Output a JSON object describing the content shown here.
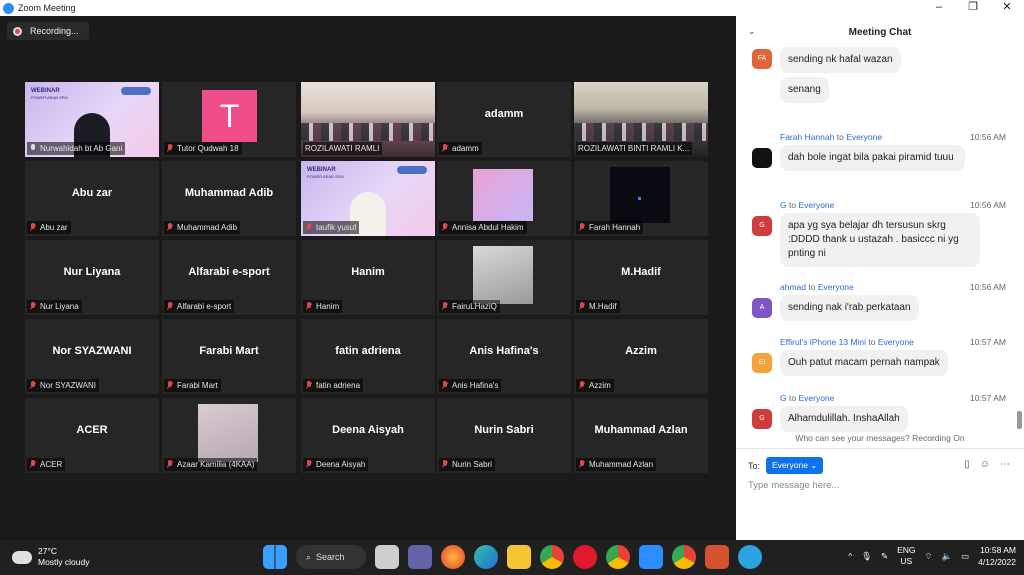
{
  "window": {
    "title": "Zoom Meeting",
    "controls": [
      "–",
      "❐",
      "✕"
    ]
  },
  "recording": {
    "label": "Recording..."
  },
  "tiles": [
    {
      "name": "Nurwahidah bt Ab Gani",
      "center": "",
      "video": "webinar-woman",
      "mic": "on"
    },
    {
      "name": "Tutor Qudwah 18",
      "center": "",
      "video": "avatar-T",
      "avatar_letter": "T",
      "mic": "off"
    },
    {
      "name": "ROZILAWATI RAMLI",
      "center": "",
      "video": "class-photo",
      "mic": "none"
    },
    {
      "name": "adamm",
      "center": "adamm",
      "video": "",
      "mic": "off"
    },
    {
      "name": "ROZILAWATI BINTI RAMLI K...",
      "center": "",
      "video": "class-photo2",
      "mic": "none"
    },
    {
      "name": "Abu zar",
      "center": "Abu zar",
      "video": "",
      "mic": "off"
    },
    {
      "name": "Muhammad Adib",
      "center": "Muhammad Adib",
      "video": "",
      "mic": "off"
    },
    {
      "name": "taufik yusuf",
      "center": "",
      "video": "webinar-man",
      "mic": "off"
    },
    {
      "name": "Annisa Abdul Hakim",
      "center": "",
      "video": "pink-thumb",
      "mic": "off"
    },
    {
      "name": "Farah Hannah",
      "center": "",
      "video": "dark-thumb",
      "mic": "off"
    },
    {
      "name": "Nur Liyana",
      "center": "Nur Liyana",
      "video": "",
      "mic": "off"
    },
    {
      "name": "Alfarabi e-sport",
      "center": "Alfarabi e-sport",
      "video": "",
      "mic": "off"
    },
    {
      "name": "Hanim",
      "center": "Hanim",
      "video": "",
      "mic": "off"
    },
    {
      "name": "FairuLHaziQ",
      "center": "",
      "video": "shoe-thumb",
      "mic": "off"
    },
    {
      "name": "M.Hadif",
      "center": "M.Hadif",
      "video": "",
      "mic": "off"
    },
    {
      "name": "Nor SYAZWANI",
      "center": "Nor SYAZWANI",
      "video": "",
      "mic": "off"
    },
    {
      "name": "Farabi Mart",
      "center": "Farabi Mart",
      "video": "",
      "mic": "off"
    },
    {
      "name": "fatin adriena",
      "center": "fatin adriena",
      "video": "",
      "mic": "off"
    },
    {
      "name": "Anis Hafina's",
      "center": "Anis Hafina's",
      "video": "",
      "mic": "off"
    },
    {
      "name": "Azzim",
      "center": "Azzim",
      "video": "",
      "mic": "off"
    },
    {
      "name": "ACER",
      "center": "ACER",
      "video": "",
      "mic": "off"
    },
    {
      "name": "Azaar Kamilia (4KAA)",
      "center": "",
      "video": "blur-thumb",
      "mic": "off"
    },
    {
      "name": "Deena Aisyah",
      "center": "Deena Aisyah",
      "video": "",
      "mic": "off"
    },
    {
      "name": "Nurin Sabri",
      "center": "Nurin Sabri",
      "video": "",
      "mic": "off"
    },
    {
      "name": "Muhammad Azlan",
      "center": "Muhammad Azlan",
      "video": "",
      "mic": "off"
    }
  ],
  "webinar": {
    "title": "WEBINAR",
    "subtitle": "POWER ARAB SPM"
  },
  "chat": {
    "title": "Meeting Chat",
    "to_word": "to",
    "messages": [
      {
        "avatar": "FA",
        "color": "#e0643c",
        "sender": "",
        "to": "",
        "time": "",
        "text": "sending nk hafal wazan"
      },
      {
        "avatar": "",
        "color": "",
        "sender": "",
        "to": "",
        "time": "",
        "text": "senang"
      },
      {
        "avatar": "",
        "color": "#111111",
        "sender": "Farah Hannah",
        "to": "Everyone",
        "time": "10:56 AM",
        "text": "dah bole ingat bila pakai piramid tuuu"
      },
      {
        "avatar": "G",
        "color": "#d13b3b",
        "sender": "G",
        "to": "Everyone",
        "time": "10:56 AM",
        "text": "apa yg sya belajar dh tersusun skrg :DDDD thank u ustazah . basiccc ni yg pnting ni"
      },
      {
        "avatar": "A",
        "color": "#7d55c7",
        "sender": "ahmad",
        "to": "Everyone",
        "time": "10:56 AM",
        "text": "sending nak i'rab perkataan"
      },
      {
        "avatar": "EI",
        "color": "#f2a33a",
        "sender": "Effirul's iPhone 13 Mini",
        "to": "Everyone",
        "time": "10:57 AM",
        "text": "Ouh patut macam pernah nampak"
      },
      {
        "avatar": "G",
        "color": "#d13b3b",
        "sender": "G",
        "to": "Everyone",
        "time": "10:57 AM",
        "text": "Alhamdulillah. InshaAllah"
      }
    ],
    "who_can_see": "Who can see your messages? Recording On",
    "to_label": "To:",
    "recipient": "Everyone ⌄",
    "input_placeholder": "Type message here..."
  },
  "taskbar": {
    "temperature": "27°C",
    "weather": "Mostly cloudy",
    "search_label": "Search",
    "lang_line1": "ENG",
    "lang_line2": "US",
    "time": "10:58 AM",
    "date": "4/12/2022",
    "apps": [
      "start",
      "search",
      "task-view",
      "teams",
      "firefox",
      "edge",
      "file-explorer",
      "chrome",
      "opera",
      "chrome-profile",
      "zoom",
      "chrome-alt",
      "powerpoint",
      "telegram"
    ]
  }
}
